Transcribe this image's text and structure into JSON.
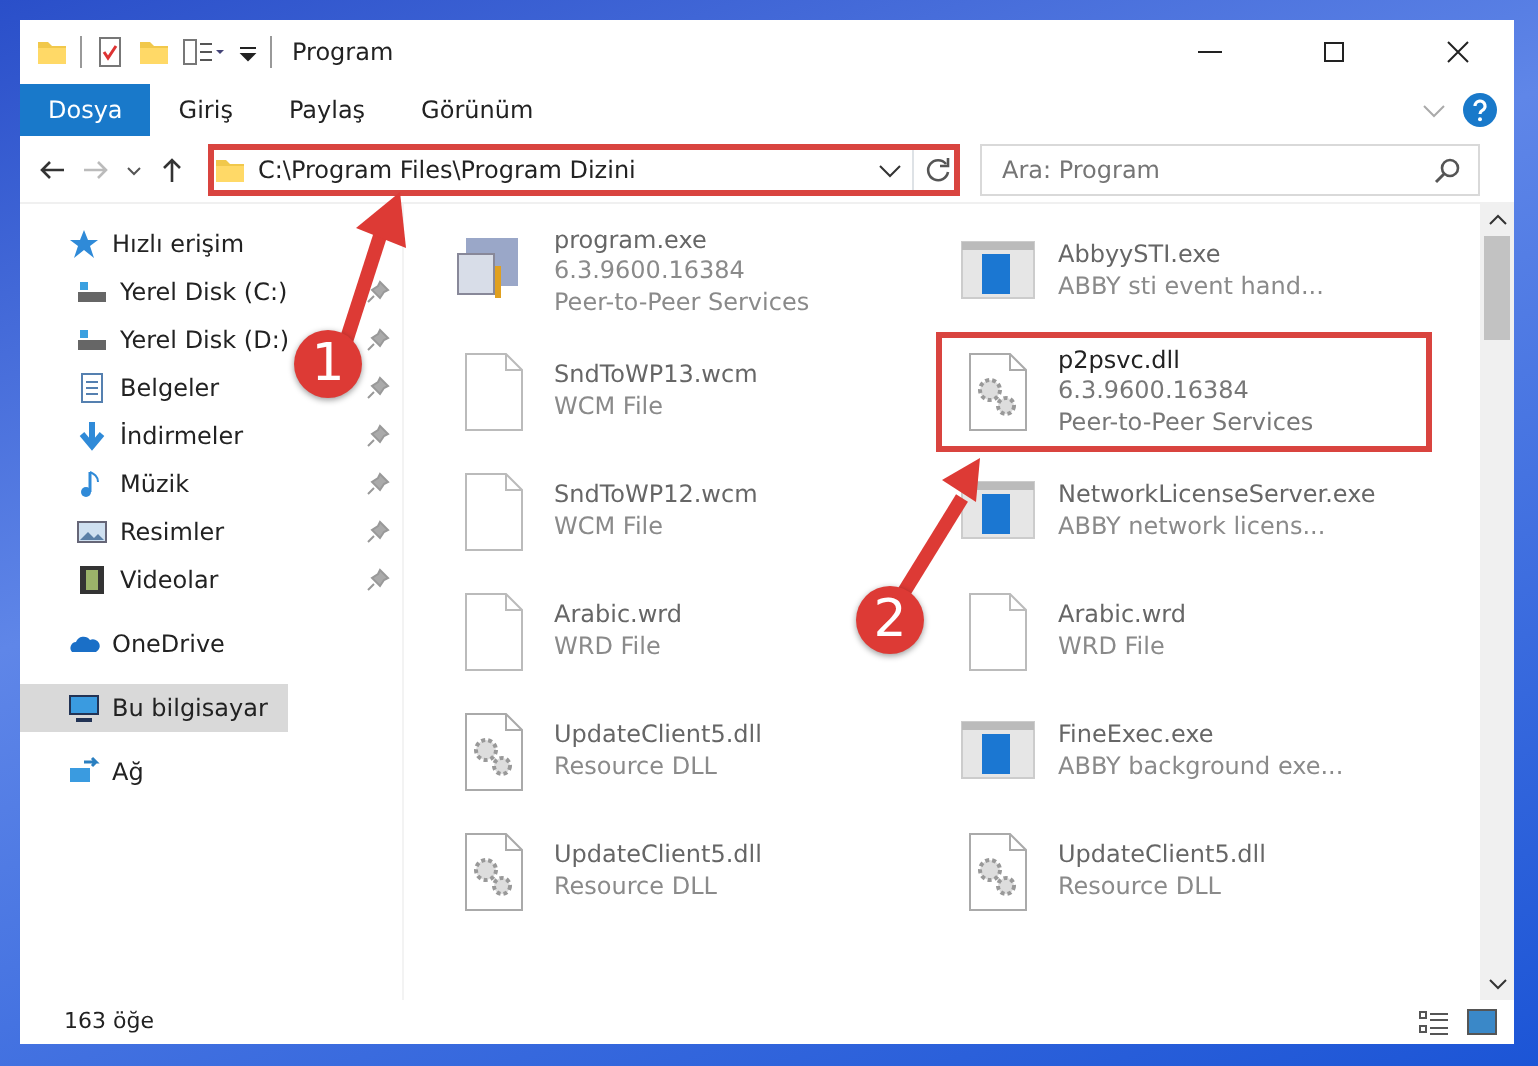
{
  "window": {
    "title": "Program"
  },
  "ribbon": {
    "tabs": [
      {
        "label": "Dosya",
        "selected": true
      },
      {
        "label": "Giriş",
        "selected": false
      },
      {
        "label": "Paylaş",
        "selected": false
      },
      {
        "label": "Görünüm",
        "selected": false
      }
    ]
  },
  "address_bar": {
    "path": "C:\\Program Files\\Program Dizini",
    "annotated": true
  },
  "search": {
    "placeholder": "Ara: Program"
  },
  "sidebar": {
    "items": [
      {
        "label": "Hızlı erişim",
        "kind": "star",
        "selected": false,
        "children": [
          {
            "label": "Yerel Disk (C:)",
            "kind": "drive",
            "pinned": true
          },
          {
            "label": "Yerel Disk (D:)",
            "kind": "drive",
            "pinned": true
          },
          {
            "label": "Belgeler",
            "kind": "docs",
            "pinned": true
          },
          {
            "label": "İndirmeler",
            "kind": "download",
            "pinned": true
          },
          {
            "label": "Müzik",
            "kind": "music",
            "pinned": true
          },
          {
            "label": "Resimler",
            "kind": "pictures",
            "pinned": true
          },
          {
            "label": "Videolar",
            "kind": "video",
            "pinned": true
          }
        ]
      },
      {
        "label": "OneDrive",
        "kind": "cloud",
        "selected": false
      },
      {
        "label": "Bu bilgisayar",
        "kind": "computer",
        "selected": true
      },
      {
        "label": "Ağ",
        "kind": "network",
        "selected": false
      }
    ]
  },
  "files": [
    {
      "name": "program.exe",
      "details": [
        "6.3.9600.16384",
        "Peer-to-Peer Services"
      ],
      "kind": "setup",
      "blurred": true,
      "annotated": false
    },
    {
      "name": "AbbyySTI.exe",
      "details": [
        "ABBY sti event hand..."
      ],
      "kind": "app",
      "blurred": true,
      "annotated": false
    },
    {
      "name": "SndToWP13.wcm",
      "details": [
        "WCM File"
      ],
      "kind": "blank",
      "blurred": true,
      "annotated": false
    },
    {
      "name": "p2psvc.dll",
      "details": [
        "6.3.9600.16384",
        "Peer-to-Peer Services"
      ],
      "kind": "dll",
      "blurred": false,
      "annotated": true
    },
    {
      "name": "SndToWP12.wcm",
      "details": [
        "WCM File"
      ],
      "kind": "blank",
      "blurred": true,
      "annotated": false
    },
    {
      "name": "NetworkLicenseServer.exe",
      "details": [
        "ABBY network licens..."
      ],
      "kind": "app",
      "blurred": true,
      "annotated": false
    },
    {
      "name": "Arabic.wrd",
      "details": [
        "WRD File"
      ],
      "kind": "blank",
      "blurred": true,
      "annotated": false
    },
    {
      "name": "Arabic.wrd",
      "details": [
        "WRD File"
      ],
      "kind": "blank",
      "blurred": true,
      "annotated": false
    },
    {
      "name": "UpdateClient5.dll",
      "details": [
        "Resource DLL"
      ],
      "kind": "dll",
      "blurred": true,
      "annotated": false
    },
    {
      "name": "FineExec.exe",
      "details": [
        "ABBY background exe..."
      ],
      "kind": "app",
      "blurred": true,
      "annotated": false
    },
    {
      "name": "UpdateClient5.dll",
      "details": [
        "Resource DLL"
      ],
      "kind": "dll",
      "blurred": true,
      "annotated": false
    },
    {
      "name": "UpdateClient5.dll",
      "details": [
        "Resource DLL"
      ],
      "kind": "dll",
      "blurred": true,
      "annotated": false
    }
  ],
  "status_bar": {
    "count": "163 öğe"
  },
  "annotations": [
    {
      "label": "1"
    },
    {
      "label": "2"
    }
  ]
}
